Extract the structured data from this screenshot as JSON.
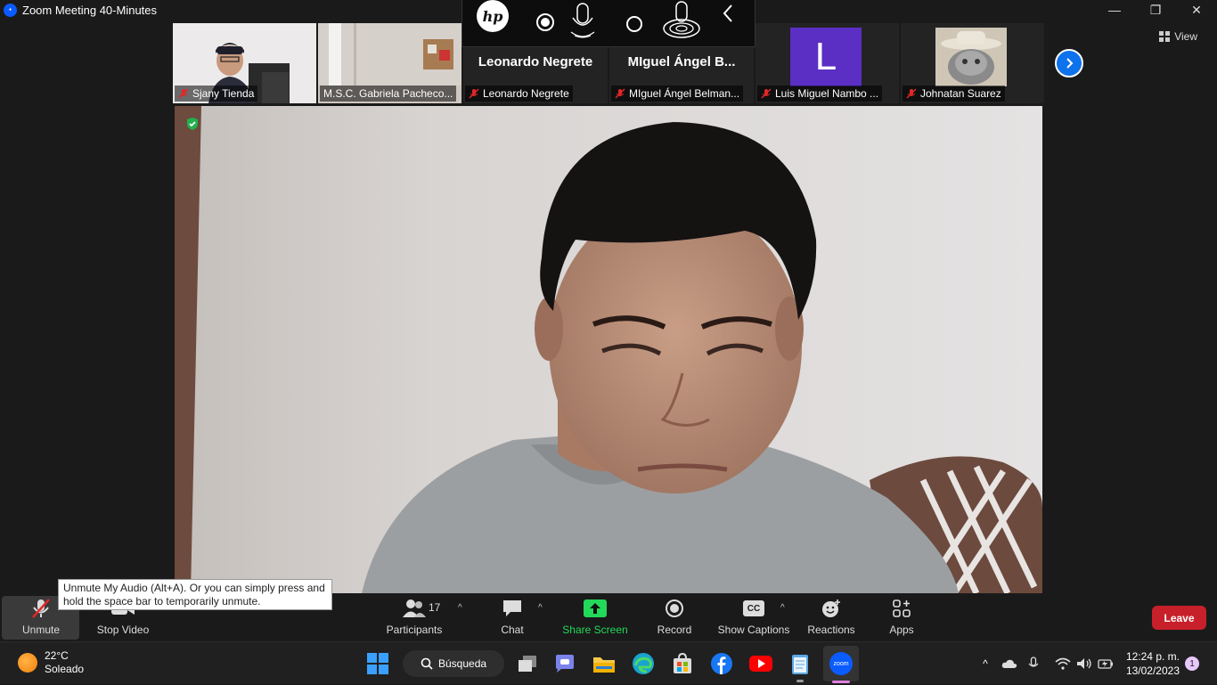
{
  "window": {
    "title": "Zoom Meeting 40-Minutes"
  },
  "hp_overlay": {
    "logo_text": "hp"
  },
  "gallery": {
    "tiles": [
      {
        "name": "Sjany Tienda"
      },
      {
        "name": "M.S.C. Gabriela Pacheco..."
      },
      {
        "name": "Leonardo Negrete",
        "big_name": "Leonardo Negrete"
      },
      {
        "name": "MIguel Ángel Belman...",
        "big_name": "MIguel Ángel B..."
      },
      {
        "name": "Luis Miguel Nambo ...",
        "avatar_letter": "L",
        "avatar_color": "#5b2ec4"
      },
      {
        "name": "Johnatan Suarez"
      }
    ],
    "view_label": "View"
  },
  "tooltip": {
    "text": "Unmute My Audio (Alt+A). Or you can simply press and hold the space bar to temporarily unmute."
  },
  "toolbar": {
    "unmute": "Unmute",
    "stop_video": "Stop Video",
    "participants": "Participants",
    "participants_count": "17",
    "chat": "Chat",
    "share_screen": "Share Screen",
    "record": "Record",
    "show_captions": "Show Captions",
    "captions_badge": "CC",
    "reactions": "Reactions",
    "apps": "Apps",
    "leave": "Leave",
    "share_color": "#23d959",
    "leave_color": "#c8202a"
  },
  "taskbar": {
    "weather_temp": "22°C",
    "weather_desc": "Soleado",
    "search_label": "Búsqueda",
    "time": "12:24 p. m.",
    "date": "13/02/2023",
    "notifications": "1",
    "zoom_label": "zoom"
  }
}
